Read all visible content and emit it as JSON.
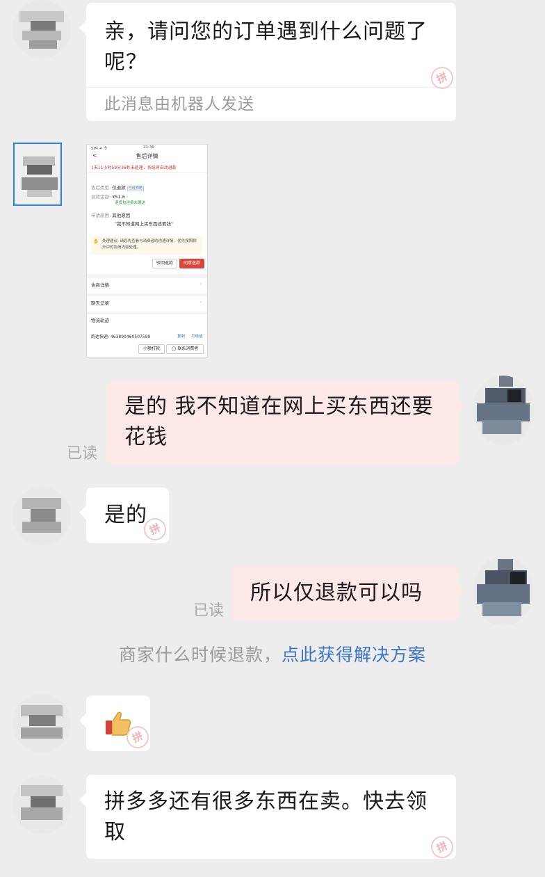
{
  "messages": {
    "m1": {
      "text": "亲，请问您的订单遇到什么问题了呢？",
      "robot_note": "此消息由机器人发送"
    },
    "m3": {
      "text": "是的 我不知道在网上买东西还要花钱",
      "read": "已读"
    },
    "m4": {
      "text": "是的"
    },
    "m5": {
      "text": "所以仅退款可以吗",
      "read": "已读"
    },
    "m7": {
      "text": "拼多多还有很多东西在卖。快去领取"
    }
  },
  "system_tip": {
    "text": "商家什么时候退款，",
    "link": "点此获得解决方案"
  },
  "screenshot": {
    "status_left": "SIM ✈ 令",
    "status_time": "21:39",
    "title": "售后详情",
    "countdown": "1天11小时59分36秒未处理，系统将自动退款",
    "type_label": "售后类型:",
    "type_value": "仅退款",
    "type_badge": "已经预赔",
    "amount_label": "退款金额:",
    "amount_value": "¥51.6",
    "amount_note": "退货包运费未赠送",
    "reason_label": "申请原因:",
    "reason_value": "其他原因",
    "reason_detail": "\"我不知道网上买东西还要钱\"",
    "suggest": "处理建议: 请您先查看与消费者的沟通详情，优先按照聊天中的协商内容处理。",
    "reject_btn": "驳回退款",
    "agree_btn": "同意退款",
    "negotiate": "协商详情",
    "chat_record": "聊天记录",
    "logistics": "物流轨迹",
    "express": "韵达快递: 463890460507599",
    "copy": "复制",
    "call": "打电话",
    "small_btn": "小额打款",
    "contact_btn": "联系消费者"
  },
  "colors": {
    "background": "#ededed",
    "bubble_left": "#ffffff",
    "bubble_right": "#fce8e6",
    "link": "#3b74c9",
    "agree": "#d9463b"
  },
  "icons": {
    "thumb": "thumbs-up-icon",
    "watermark": "pinduoduo-watermark-icon"
  }
}
